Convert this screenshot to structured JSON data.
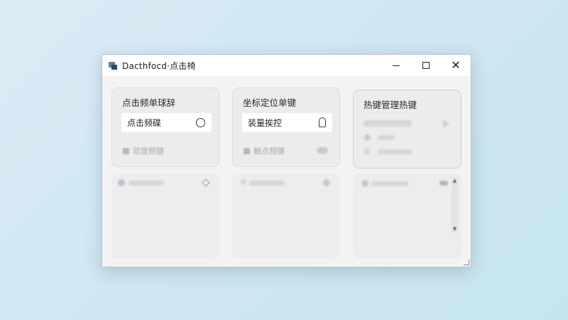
{
  "window": {
    "title": "Dacthfocd·点击椅",
    "controls": {
      "minimize": "–",
      "maximize": "□",
      "close": "✕"
    }
  },
  "cards": [
    {
      "title": "点击频单球辞",
      "field_label": "点击频碟",
      "field_icon": "radio-icon",
      "footer_label": "驳度频键"
    },
    {
      "title": "坐标定位单键",
      "field_label": "装量挨控",
      "field_icon": "bell-icon",
      "footer_label": "触点频键"
    },
    {
      "title": "热键管理热键"
    }
  ],
  "icons": {
    "app": "app-icon",
    "play": "play-icon",
    "location": "location-pin-icon",
    "diamond": "diamond-icon"
  },
  "colors": {
    "window_bg": "#f3f3f3",
    "card_bg": "#ececec",
    "desktop_bg": "#cfe6f2"
  }
}
